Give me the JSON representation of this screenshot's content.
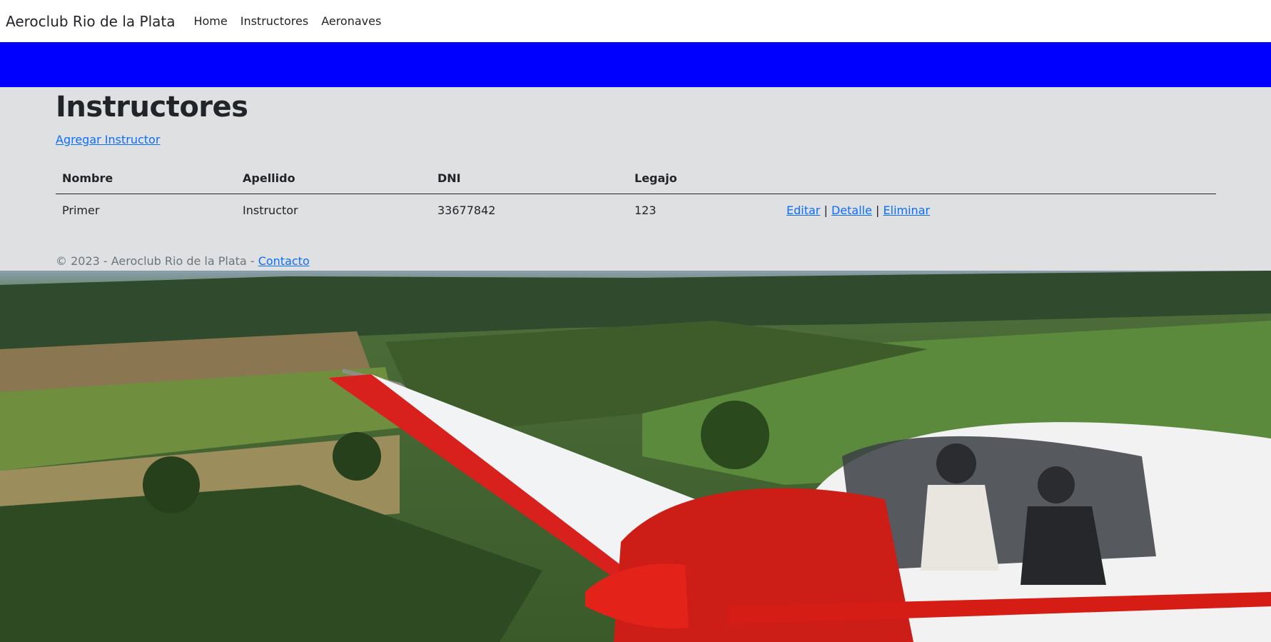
{
  "navbar": {
    "brand": "Aeroclub Rio de la Plata",
    "links": [
      "Home",
      "Instructores",
      "Aeronaves"
    ]
  },
  "page": {
    "title": "Instructores",
    "add_link": "Agregar Instructor"
  },
  "table": {
    "headers": [
      "Nombre",
      "Apellido",
      "DNI",
      "Legajo"
    ],
    "rows": [
      {
        "nombre": "Primer",
        "apellido": "Instructor",
        "dni": "33677842",
        "legajo": "123",
        "actions": {
          "edit": "Editar",
          "sep1": "|",
          "detail": "Detalle",
          "sep2": "|",
          "delete": "Eliminar"
        }
      }
    ]
  },
  "footer": {
    "text": "© 2023 - Aeroclub Rio de la Plata - ",
    "contact": "Contacto"
  },
  "colors": {
    "banner": "#0000ff",
    "content_bg": "#dee0e1",
    "link": "#0d6efd"
  }
}
